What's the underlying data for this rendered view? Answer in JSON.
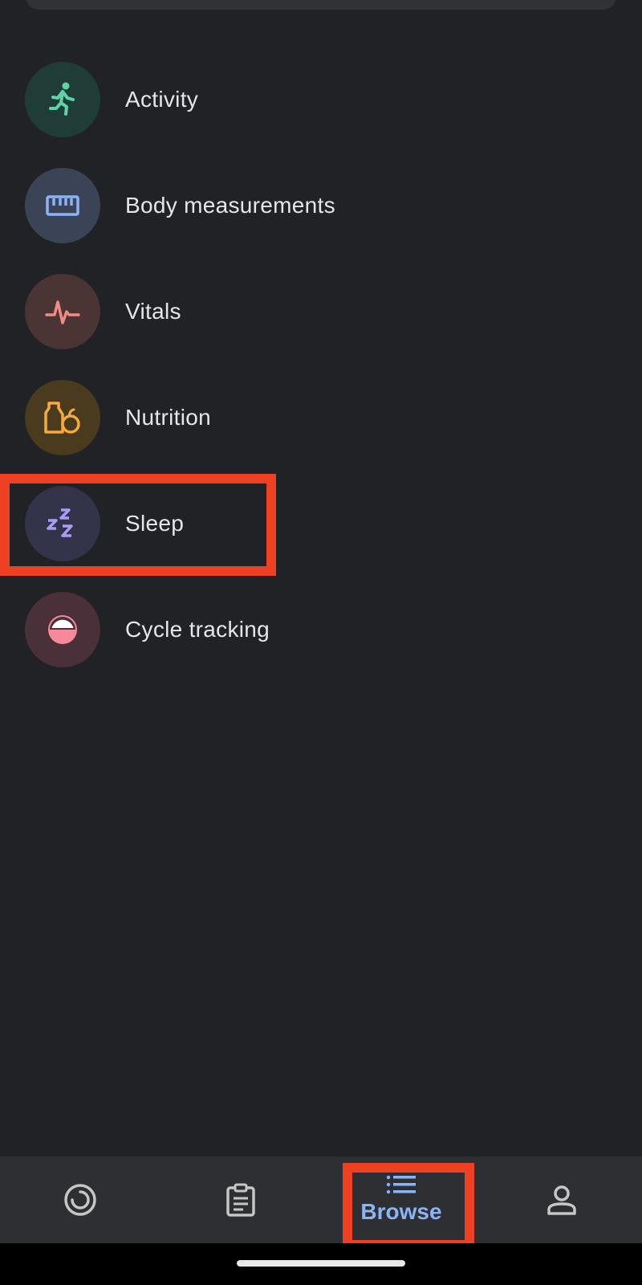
{
  "categories": [
    {
      "label": "Activity",
      "icon": "running-person-icon",
      "bg": "#1f3d36",
      "fg": "#5ed3a8"
    },
    {
      "label": "Body measurements",
      "icon": "ruler-icon",
      "bg": "#3b4457",
      "fg": "#8ab4f8"
    },
    {
      "label": "Vitals",
      "icon": "heart-pulse-icon",
      "bg": "#4a3434",
      "fg": "#f28b82"
    },
    {
      "label": "Nutrition",
      "icon": "food-icon",
      "bg": "#4a3a1e",
      "fg": "#f6aa3d"
    },
    {
      "label": "Sleep",
      "icon": "sleep-zzz-icon",
      "bg": "#33334a",
      "fg": "#aa9cf5"
    },
    {
      "label": "Cycle tracking",
      "icon": "cycle-icon",
      "bg": "#4a3038",
      "fg": "#f48a9b"
    }
  ],
  "bottom_nav": {
    "tabs": [
      {
        "name": "tab-summary",
        "icon": "summary-ring-icon",
        "label": ""
      },
      {
        "name": "tab-journal",
        "icon": "clipboard-icon",
        "label": ""
      },
      {
        "name": "tab-browse",
        "icon": "list-icon",
        "label": "Browse",
        "selected": true
      },
      {
        "name": "tab-profile",
        "icon": "person-icon",
        "label": ""
      }
    ],
    "active_color": "#8ab4f8",
    "inactive_color": "#c4c7c5"
  },
  "highlight_color": "#ee4124"
}
